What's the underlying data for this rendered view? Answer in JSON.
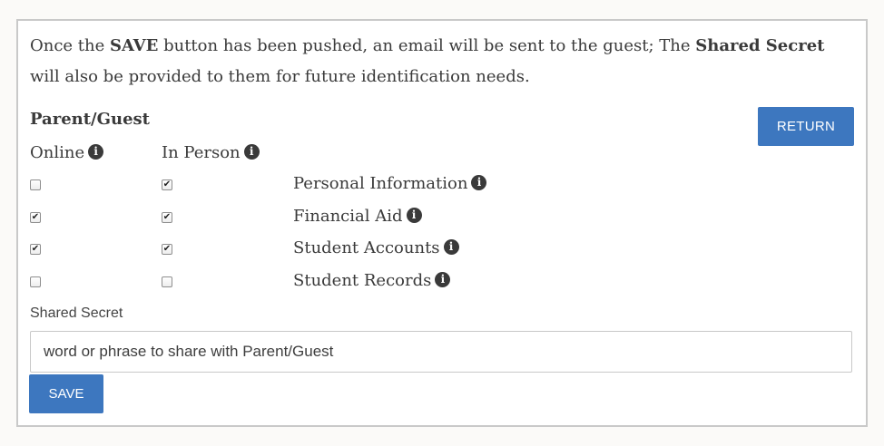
{
  "intro": {
    "part1": "Once the ",
    "save_word": "SAVE",
    "part2": " button has been pushed, an email will be sent to the guest; The ",
    "shared_secret_word": "Shared Secret",
    "part3": " will also be provided to them for future identification needs."
  },
  "section_title": "Parent/Guest",
  "return_label": "RETURN",
  "columns": {
    "online": "Online",
    "in_person": "In Person"
  },
  "info_icon_glyph": "i",
  "permissions": [
    {
      "label": "Personal Information",
      "online": false,
      "in_person": true
    },
    {
      "label": "Financial Aid",
      "online": true,
      "in_person": true
    },
    {
      "label": "Student Accounts",
      "online": true,
      "in_person": true
    },
    {
      "label": "Student Records",
      "online": false,
      "in_person": false
    }
  ],
  "shared_secret": {
    "label": "Shared Secret",
    "placeholder": "word or phrase to share with Parent/Guest",
    "value": ""
  },
  "save_label": "SAVE",
  "colors": {
    "button_blue": "#3d77bf",
    "panel_border": "#c9c9c9",
    "text": "#3a3a3a"
  }
}
